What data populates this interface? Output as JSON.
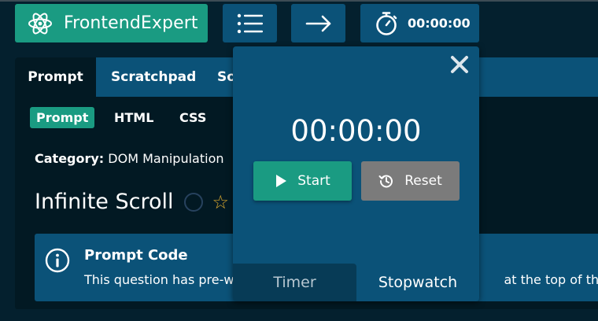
{
  "header": {
    "logo_text": "FrontendExpert",
    "timer_display": "00:00:00"
  },
  "tabs": [
    {
      "label": "Prompt"
    },
    {
      "label": "Scratchpad"
    },
    {
      "label": "So"
    }
  ],
  "subtabs": [
    {
      "label": "Prompt"
    },
    {
      "label": "HTML"
    },
    {
      "label": "CSS"
    }
  ],
  "question": {
    "category_label": "Category:",
    "category_value": "DOM Manipulation",
    "title": "Infinite Scroll"
  },
  "callout": {
    "title": "Prompt Code",
    "body_left": "This question has pre-w",
    "body_right": "at the top of this pa"
  },
  "stopwatch": {
    "time": "00:00:00",
    "start_label": "Start",
    "reset_label": "Reset",
    "mode_tabs": [
      "Timer",
      "Stopwatch"
    ]
  },
  "colors": {
    "accent_green": "#1a9b82",
    "nav_blue": "#0b5278",
    "background": "#021923",
    "reset_gray": "#7b7b7b",
    "star": "#d9a72e"
  },
  "icons": [
    "atom-icon",
    "menu-icon",
    "arrow-right-icon",
    "stopwatch-icon",
    "close-icon",
    "play-icon",
    "reset-icon",
    "circle-icon",
    "star-icon",
    "info-icon"
  ]
}
